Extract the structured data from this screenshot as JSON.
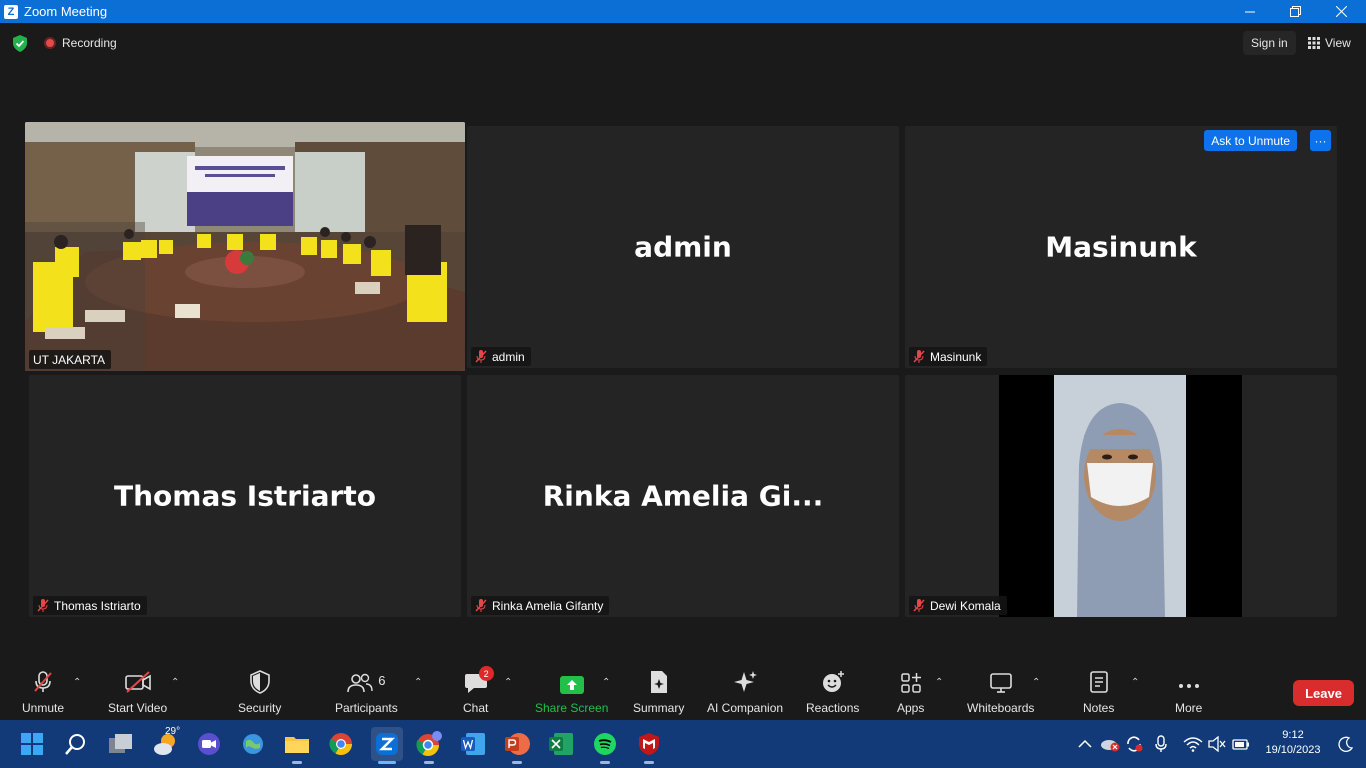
{
  "window": {
    "title": "Zoom Meeting"
  },
  "topbar": {
    "recording_label": "Recording",
    "signin_label": "Sign in",
    "view_label": "View"
  },
  "tiles": [
    {
      "name": "UT JAKARTA"
    },
    {
      "name": "admin",
      "big": "admin"
    },
    {
      "name": "Masinunk",
      "big": "Masinunk"
    },
    {
      "name": "Thomas Istriarto",
      "big": "Thomas Istriarto"
    },
    {
      "name": "Rinka Amelia Gifanty",
      "big": "Rinka Amelia Gi..."
    },
    {
      "name": "Dewi Komala"
    }
  ],
  "ask_unmute_label": "Ask to Unmute",
  "more_dots": "···",
  "toolbar": {
    "unmute": "Unmute",
    "start_video": "Start Video",
    "security": "Security",
    "participants": "Participants",
    "participants_count": "6",
    "chat": "Chat",
    "chat_badge": "2",
    "share_screen": "Share Screen",
    "summary": "Summary",
    "ai_companion": "AI Companion",
    "reactions": "Reactions",
    "apps": "Apps",
    "whiteboards": "Whiteboards",
    "notes": "Notes",
    "more": "More",
    "leave": "Leave"
  },
  "colors": {
    "accent": "#0e72ed",
    "leave": "#d92d2d",
    "active_border": "#d6e25a",
    "share_green": "#22c04a",
    "taskbar": "#123a78"
  },
  "taskbar": {
    "weather_temp": "29°",
    "time": "9:12",
    "date": "19/10/2023"
  }
}
